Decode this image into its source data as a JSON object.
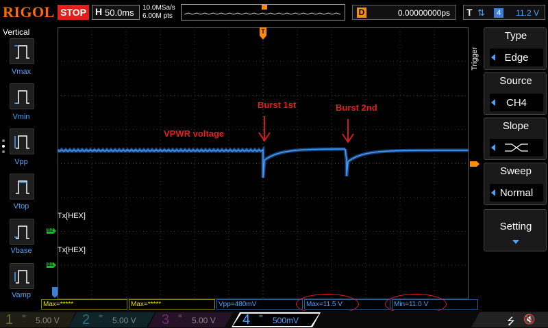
{
  "top_bar": {
    "logo": "RIGOL",
    "run_status": "STOP",
    "timebase_label": "H",
    "timebase_value": "50.0ms",
    "sample_rate": "10.0MSa/s",
    "memory_depth": "6.00M pts",
    "delay_label": "D",
    "delay_value": "0.00000000ps",
    "trigger_label": "T",
    "trigger_edge_icon": "rising-falling-edge-icon",
    "trigger_source_num": "4",
    "trigger_level": "11.2 V"
  },
  "left_panel": {
    "title": "Vertical",
    "items": [
      {
        "label": "Vmax"
      },
      {
        "label": "Vmin"
      },
      {
        "label": "Vpp"
      },
      {
        "label": "Vtop"
      },
      {
        "label": "Vbase"
      },
      {
        "label": "Vamp"
      }
    ]
  },
  "waveform": {
    "annotations": {
      "vpwr": "VPWR voltage",
      "burst1": "Burst 1st",
      "burst2": "Burst 2nd"
    },
    "bus_labels": [
      "Tx[HEX]",
      "Tx[HEX]"
    ],
    "bus_markers": [
      "B2",
      "B1"
    ],
    "trigger_marker": "T",
    "colors": {
      "ch4": "#2f7ee0",
      "annotation": "#e81c1c",
      "grid": "#3a3a3a"
    }
  },
  "right_menu": {
    "tab_label": "Trigger",
    "items": [
      {
        "title": "Type",
        "value": "Edge"
      },
      {
        "title": "Source",
        "value": "CH4"
      },
      {
        "title": "Slope",
        "value": ""
      },
      {
        "title": "Sweep",
        "value": "Normal"
      },
      {
        "title": "Setting",
        "value": ""
      }
    ]
  },
  "measurements": [
    {
      "text": "Max=*****",
      "color": "yellow"
    },
    {
      "text": "Max=*****",
      "color": "yellow"
    },
    {
      "text": "Vpp=480mV",
      "color": "blue"
    },
    {
      "text": "Max=11.5 V",
      "color": "blue"
    },
    {
      "text": "Min=11.0 V",
      "color": "blue"
    }
  ],
  "channels": [
    {
      "num": "1",
      "coupling": "=",
      "scale": "5.00 V",
      "color": "#e8e000"
    },
    {
      "num": "2",
      "coupling": "=",
      "scale": "5.00 V",
      "color": "#00c8ff"
    },
    {
      "num": "3",
      "coupling": "=",
      "scale": "5.00 V",
      "color": "#e040e0"
    },
    {
      "num": "4",
      "coupling": "=",
      "scale": "500mV",
      "color": "#3d7fd6"
    }
  ]
}
